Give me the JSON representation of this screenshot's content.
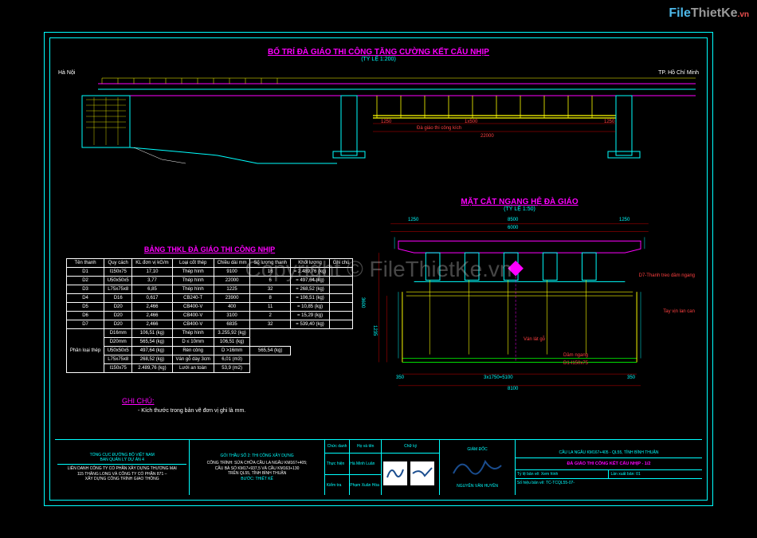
{
  "watermark": {
    "file": "File",
    "thietke": "ThietKe",
    "vn": ".vn",
    "center": "Copyright © FileThietKe.vn"
  },
  "elevation": {
    "title": "BỐ TRÍ ĐÀ GIÁO THI CÔNG TĂNG CƯỜNG KẾT CẤU NHỊP",
    "scale": "(TỶ LỆ 1:200)",
    "left_dir": "Hà Nội",
    "right_dir": "TP. Hồ Chí Minh",
    "dims": {
      "d1": "1250",
      "d2": "1x500",
      "d3": "1250",
      "d4": "22000",
      "note": "Đà giáo thi công kích"
    }
  },
  "section": {
    "title": "MẶT CẮT NGANG HỆ ĐÀ GIÁO",
    "scale": "(TỶ LỆ 1:50)",
    "dims": {
      "top1": "1250",
      "top2": "8500",
      "top3": "1250",
      "top4": "6000",
      "side1": "3600",
      "side2": "1235",
      "bot1": "350",
      "bot2": "3x1750=5100",
      "bot3": "350",
      "bot4": "8100",
      "labels": {
        "l1": "D7-Thanh treo dầm ngang",
        "l2": "Tay vịn lan can",
        "l3": "Ván lát gỗ",
        "l4": "Dầm ngang",
        "l5": "D1-I150x75"
      }
    }
  },
  "table": {
    "title": "BẢNG THKL ĐÀ GIÁO THI CÔNG NHỊP",
    "headers": [
      "Tên thanh",
      "Quy cách",
      "KL đơn vị\nkG/m",
      "Loại cốt thép",
      "Chiều dài\nmm",
      "Số lượng\nthanh",
      "Khối lượng",
      "Ghi chú"
    ],
    "rows": [
      [
        "D1",
        "I150x75",
        "17,10",
        "Thép hình",
        "9100",
        "16",
        "=",
        "2.489,76 (kg)",
        ""
      ],
      [
        "D2",
        "U50x50x5",
        "3,77",
        "Thép hình",
        "22000",
        "6",
        "=",
        "497,64 (kg)",
        ""
      ],
      [
        "D3",
        "L75x75x8",
        "6,85",
        "Thép hình",
        "1225",
        "32",
        "=",
        "268,52 (kg)",
        ""
      ],
      [
        "D4",
        "D16",
        "0,617",
        "CB240-T",
        "23900",
        "8",
        "=",
        "106,51 (kg)",
        ""
      ],
      [
        "D5",
        "D20",
        "2,466",
        "CB400-V",
        "400",
        "11",
        "=",
        "10,85 (kg)",
        ""
      ],
      [
        "D6",
        "D20",
        "2,466",
        "CB400-V",
        "3100",
        "2",
        "=",
        "15,29 (kg)",
        ""
      ],
      [
        "D7",
        "D20",
        "2,466",
        "CB400-V",
        "6835",
        "32",
        "=",
        "539,40 (kg)",
        ""
      ]
    ],
    "summary_label": "Phân loại thép",
    "summary": [
      [
        "D16mm",
        "106,51 (kg)",
        "Thép hình",
        "3.255,92 (kg)"
      ],
      [
        "D20mm",
        "565,54 (kg)",
        "D ≤ 10mm",
        "106,51 (kg)"
      ],
      [
        "U50x50x5",
        "497,64 (kg)",
        "Rèn công",
        "D >16mm",
        "565,54 (kg)"
      ],
      [
        "L75x75x8",
        "268,52 (kg)",
        "Ván gỗ dày 3cm",
        "6,01 (m3)"
      ],
      [
        "I150x75",
        "2.489,76 (kg)",
        "Lưới an toàn",
        "53,9 (m2)"
      ]
    ]
  },
  "ghichu": {
    "title": "GHI CHÚ:",
    "note": "- Kích thước trong bản vẽ đơn vị ghi là mm."
  },
  "titleblock": {
    "col1": {
      "l1": "TỔNG CỤC ĐƯỜNG BỘ VIỆT NAM",
      "l2": "BAN QUẢN LÝ DỰ ÁN 4",
      "l3": "LIÊN DANH CÔNG TY CỔ PHẦN XÂY DỰNG THƯƠNG MẠI",
      "l4": "115 THĂNG LONG VÀ CÔNG TY CỔ PHẦN 871 –",
      "l5": "XÂY DỰNG CÔNG TRÌNH GIAO THÔNG"
    },
    "col2": {
      "l1": "GÓI THẦU SỐ 2: THI CÔNG XÂY DỰNG",
      "l2": "CÔNG TRÌNH: SỬA CHỮA CẦU LA NGÂU KM167+405;",
      "l3": "CẦU BÀ SỔ KM17+937,5 VÀ CẦU KM163+130",
      "l4": "TRÊN QL55, TỈNH BÌNH THUẬN",
      "l5": "BƯỚC: THIẾT KẾ"
    },
    "col3": {
      "r1a": "Chức danh",
      "r1b": "Họ và tên",
      "r1c": "Chữ ký",
      "r2a": "Thực hiện",
      "r2b": "Hà Minh Luân",
      "r3a": "Kiểm tra",
      "r3b": "Phạm Xuân Hòa"
    },
    "col4": {
      "l1": "GIÁM ĐỐC",
      "l2": "NGUYỄN VĂN HUYỀN"
    },
    "col5": {
      "l1": "CẦU LA NGÂU KM167+405 - QL55, TỈNH BÌNH THUẬN",
      "l2": "ĐÀ GIÁO THI CÔNG KẾT CẤU NHỊP - 1/2",
      "l3a": "Tỷ lệ bản vẽ: Xem hình",
      "l3b": "Lần xuất bản: 01",
      "l4": "Số hiệu bản vẽ: TC-TCQL55-07-"
    }
  }
}
